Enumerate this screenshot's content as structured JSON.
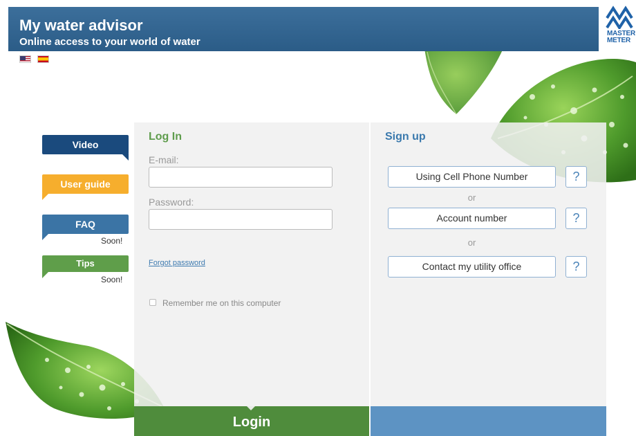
{
  "header": {
    "title": "My water advisor",
    "subtitle": "Online access to your world of water",
    "logo_line1": "MASTER",
    "logo_line2": "METER"
  },
  "flags": [
    {
      "name": "english-flag-icon"
    },
    {
      "name": "spanish-flag-icon"
    }
  ],
  "side_tabs": {
    "video": "Video",
    "user_guide": "User guide",
    "faq": "FAQ",
    "faq_soon": "Soon!",
    "tips": "Tips",
    "tips_soon": "Soon!"
  },
  "login": {
    "title": "Log In",
    "email_label": "E-mail:",
    "email_value": "",
    "password_label": "Password:",
    "password_value": "",
    "forgot_password": "Forgot password",
    "remember_me": "Remember me on this computer",
    "remember_checked": false,
    "button_label": "Login"
  },
  "signup": {
    "title": "Sign up",
    "options": [
      {
        "label": "Using Cell Phone Number",
        "help": "?"
      },
      {
        "label": "Account number",
        "help": "?"
      },
      {
        "label": "Contact my utility office",
        "help": "?"
      }
    ],
    "separator": "or"
  },
  "colors": {
    "header_blue": "#2b5c87",
    "login_green": "#5e9c4c",
    "signup_blue": "#3a79ad",
    "tab_video": "#1a4a7d",
    "tab_guide": "#f6ae2d",
    "tab_faq": "#3b74a5",
    "tab_tips": "#5f9e4a"
  }
}
